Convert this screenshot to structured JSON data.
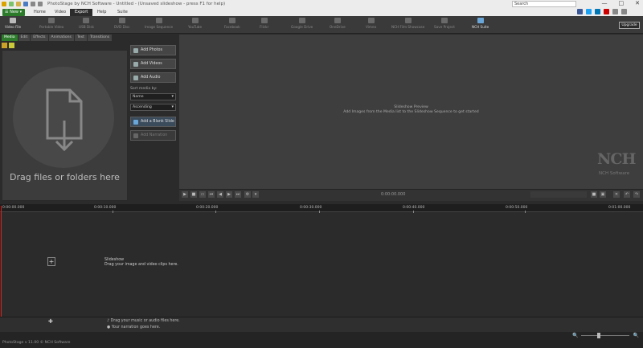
{
  "window": {
    "title": "PhotoStage by NCH Software - Untitled - (Unsaved slideshow - press F1 for help)",
    "search_placeholder": "Search",
    "controls": [
      "—",
      "□",
      "✕"
    ]
  },
  "menu": {
    "new_label": "New",
    "tabs": [
      "Home",
      "Video",
      "Export",
      "Help",
      "Suite"
    ],
    "active_tab": "Export"
  },
  "toolbar": {
    "buttons": [
      "Video File",
      "Portable Video",
      "USB Disk",
      "DVD Disc",
      "Image Sequence",
      "YouTube",
      "Facebook",
      "Flickr",
      "Google Drive",
      "OneDrive",
      "Vimeo",
      "NCH Film Showcase",
      "Save Project",
      "NCH Suite"
    ],
    "upgrade_label": "Upgrade"
  },
  "left_panel": {
    "tabs": [
      "Media",
      "Edit",
      "Effects",
      "Animations",
      "Text",
      "Transitions"
    ],
    "active_tab": "Media",
    "drop_text": "Drag files or folders here",
    "add_photos": "Add Photos",
    "add_videos": "Add Videos",
    "add_audio": "Add Audio",
    "sort_label": "Sort media by:",
    "sort_value": "Name",
    "order_value": "Ascending",
    "add_blank_slide": "Add a Blank Slide",
    "add_narration": "Add Narration"
  },
  "preview": {
    "title": "Slideshow Preview",
    "subtitle": "Add Images from the Media list to the Slideshow Sequence to get started",
    "brand": "NCH",
    "brand_sub": "NCH Software",
    "timecode": "0:00:00.000"
  },
  "timeline": {
    "ticks": [
      "0:00:00.000",
      "0:00:10.000",
      "0:00:20.000",
      "0:00:30.000",
      "0:00:40.000",
      "0:00:50.000",
      "0:01:00.000"
    ],
    "slideshow_label": "Slideshow",
    "slideshow_hint": "Drag your image and video clips here.",
    "music_hint": "Drag your music or audio files here.",
    "narration_hint": "Your narration goes here."
  },
  "status": {
    "text": "PhotoStage v 11.00 © NCH Software"
  },
  "colors": {
    "accent_green": "#2d7d2d",
    "playhead_red": "#e02020"
  }
}
